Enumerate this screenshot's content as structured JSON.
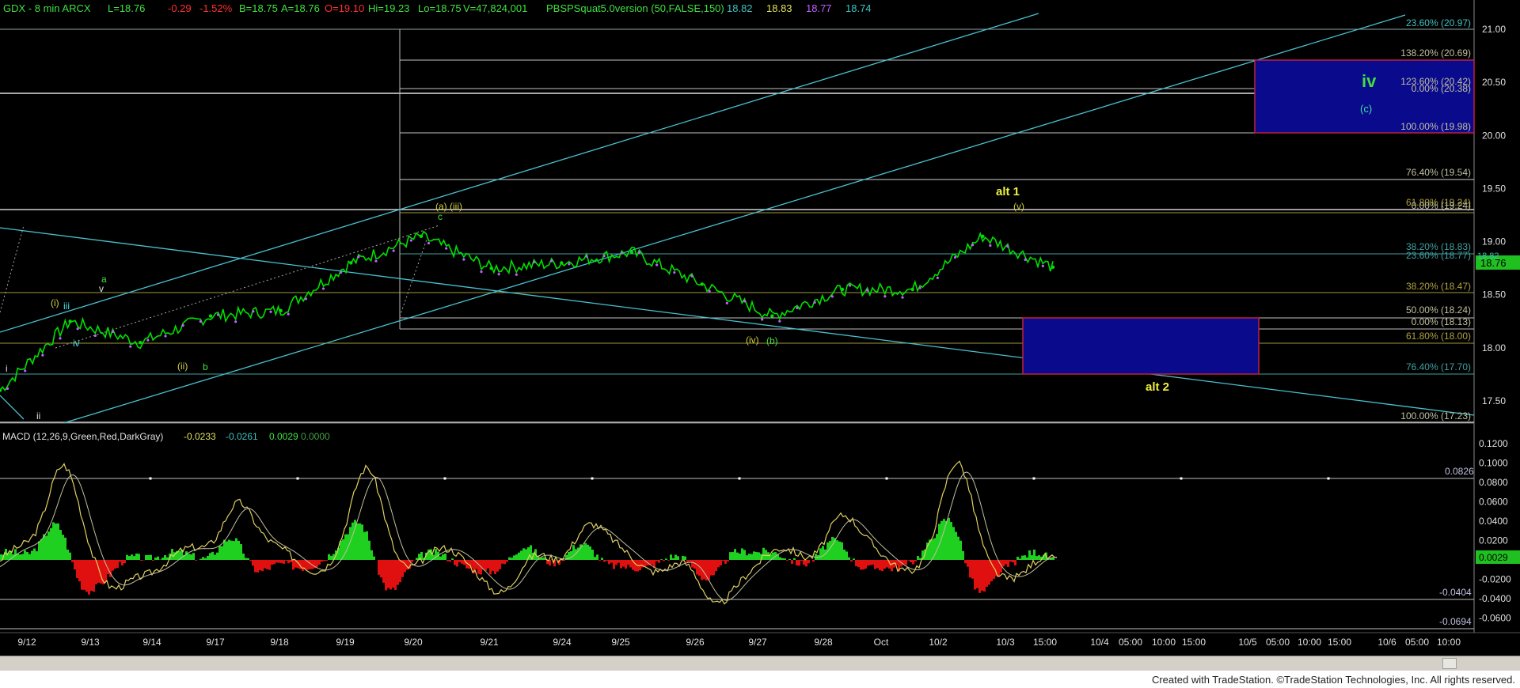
{
  "header": {
    "symbol": "GDX - 8 min  ARCX",
    "last": "L=18.76",
    "chg": "-0.29",
    "pct": "-1.52%",
    "bid": "B=18.75",
    "ask": "A=18.76",
    "open": "O=19.10",
    "hi": "Hi=19.23",
    "lo": "Lo=18.75",
    "vol": "V=47,824,001",
    "indicator": "PBSPSquat5.0version (50,FALSE,150)",
    "v1": "18.82",
    "v2": "18.83",
    "v3": "18.77",
    "v4": "18.74"
  },
  "colors": {
    "background": "#000000",
    "price": "#00e000",
    "fib": "#c0c0a0",
    "channel": "#48c0d0",
    "box": "#0a0a8c",
    "box_border": "#c02040",
    "yellow": "#f0f040",
    "green": "#40e040",
    "cyan": "#40e0e0"
  },
  "price_axis": {
    "ticks": [
      "21.00",
      "20.50",
      "20.00",
      "19.50",
      "19.00",
      "18.50",
      "18.00",
      "17.50"
    ],
    "last_tag": "18.76",
    "last_tag2": "18.82"
  },
  "x_axis": {
    "labels": [
      "9/12",
      "9/13",
      "9/14",
      "9/17",
      "9/18",
      "9/19",
      "9/20",
      "9/21",
      "9/24",
      "9/25",
      "9/26",
      "9/27",
      "9/28",
      "Oct",
      "10/2",
      "10/3",
      "15:00",
      "10/4",
      "05:00",
      "10:00",
      "15:00",
      "10/5",
      "05:00",
      "10:00",
      "15:00",
      "10/6",
      "05:00",
      "10:00"
    ]
  },
  "fib_labels": [
    {
      "text": "23.60% (20.97)",
      "color": "#40c0c0"
    },
    {
      "text": "138.20% (20.69)",
      "color": "#c0c0a0"
    },
    {
      "text": "123.60% (20.42)",
      "color": "#c0c0a0"
    },
    {
      "text": "0.00% (20.38)",
      "color": "#c0c0a0"
    },
    {
      "text": "100.00% (19.98)",
      "color": "#c0c0a0"
    },
    {
      "text": "76.40% (19.54)",
      "color": "#c0c0a0"
    },
    {
      "text": "61.80% (19.24)",
      "color": "#b0a040"
    },
    {
      "text": "0.00% (19.24)",
      "color": "#c0c0a0"
    },
    {
      "text": "38.20% (18.83)",
      "color": "#40a0a0"
    },
    {
      "text": "23.60% (18.77)",
      "color": "#40a0a0"
    },
    {
      "text": "38.20% (18.47)",
      "color": "#b0a040"
    },
    {
      "text": "50.00% (18.24)",
      "color": "#c0c0a0"
    },
    {
      "text": "0.00% (18.13)",
      "color": "#c0c0a0"
    },
    {
      "text": "61.80% (18.00)",
      "color": "#b0a040"
    },
    {
      "text": "76.40% (17.70)",
      "color": "#40a0a0"
    },
    {
      "text": "100.00% (17.23)",
      "color": "#c0c0a0"
    }
  ],
  "wave_labels": {
    "iv_big": "iv",
    "c_target": "(c)",
    "alt1": "alt 1",
    "alt2": "alt 2",
    "v_top": "(v)",
    "a_iii": "(a) (iii)",
    "c_small": "c",
    "iv_b": "(iv)",
    "b_paren": "(b)",
    "i_paren": "(i)",
    "iii_small": "iii",
    "iv_small": "iv",
    "a_small": "a",
    "v_small": "v",
    "ii_paren": "(ii)",
    "b_small": "b",
    "i_small": "i",
    "ii_small": "ii"
  },
  "macd": {
    "title": "MACD (12,26,9,Green,Red,DarkGray)",
    "v1": "-0.0233",
    "v2": "-0.0261",
    "v3": "0.0029",
    "v4": "0.0000",
    "ticks": [
      "0.1200",
      "0.1000",
      "0.0800",
      "0.0600",
      "0.0400",
      "0.0200",
      "-0.0200",
      "-0.0400",
      "-0.0600"
    ],
    "tag_upper": "0.0826",
    "tag_zero": "0.0029",
    "tag_lower": "-0.0404",
    "tag_lower2": "-0.0694"
  },
  "footer": "Created with TradeStation. ©TradeStation Technologies, Inc. All rights reserved.",
  "chart_data": {
    "type": "line",
    "title": "GDX - 8 min  ARCX",
    "x": [
      "9/12",
      "9/13",
      "9/14",
      "9/17",
      "9/18",
      "9/19",
      "9/20",
      "9/21",
      "9/24",
      "9/25",
      "9/26",
      "9/27",
      "9/28",
      "Oct",
      "10/2",
      "10/3"
    ],
    "series": [
      {
        "name": "GDX",
        "values": [
          17.6,
          18.25,
          18.05,
          18.3,
          18.35,
          18.8,
          19.05,
          18.75,
          18.8,
          18.9,
          18.6,
          18.3,
          18.55,
          18.55,
          19.05,
          18.76
        ]
      }
    ],
    "ylim": [
      17.2,
      21.1
    ],
    "levels": [
      20.97,
      20.69,
      20.42,
      20.38,
      19.98,
      19.54,
      19.24,
      18.83,
      18.77,
      18.47,
      18.24,
      18.13,
      18.0,
      17.7,
      17.23
    ],
    "xlabel": "",
    "ylabel": ""
  }
}
